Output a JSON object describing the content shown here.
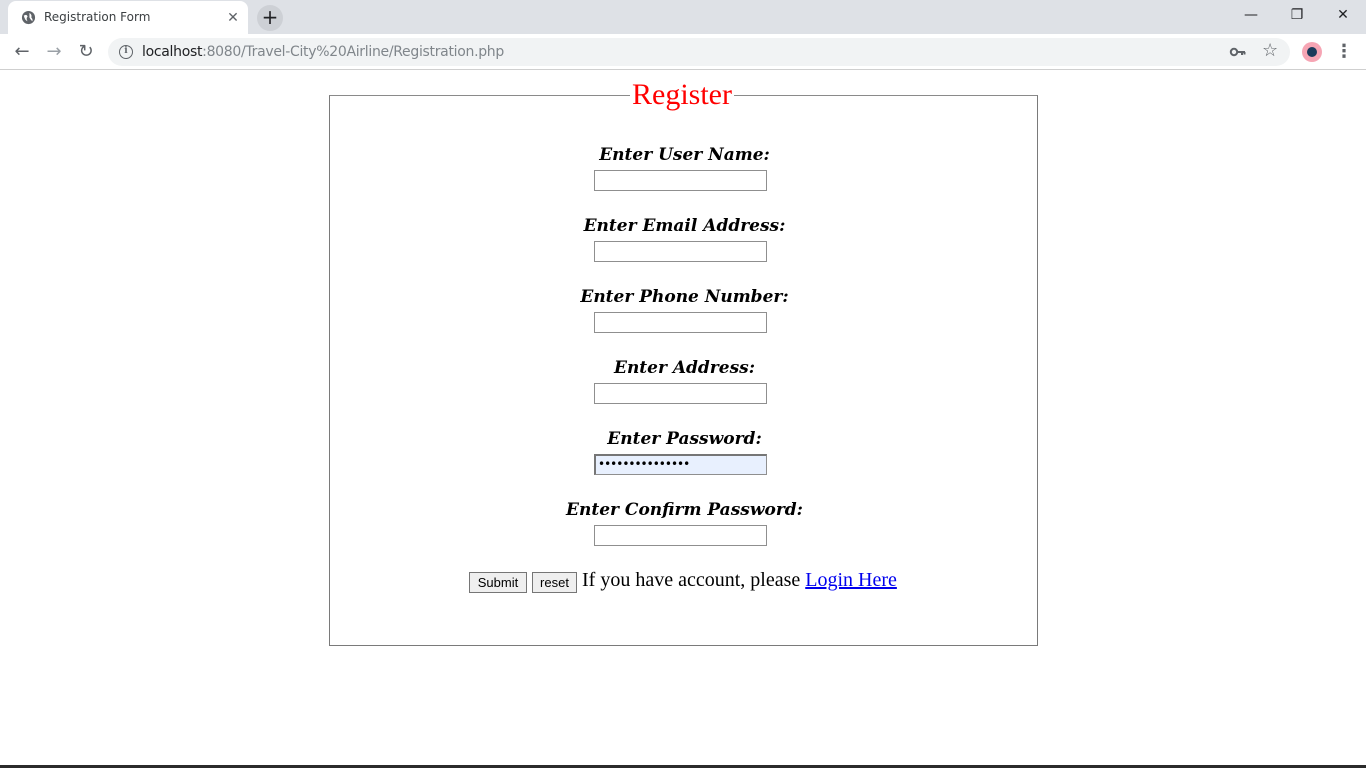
{
  "browser": {
    "tab_title": "Registration Form",
    "url_host": "localhost",
    "url_rest": ":8080/Travel-City%20Airline/Registration.php"
  },
  "form": {
    "legend": "Register",
    "fields": [
      {
        "label": "Enter User Name:",
        "value": ""
      },
      {
        "label": "Enter Email Address:",
        "value": ""
      },
      {
        "label": "Enter Phone Number:",
        "value": ""
      },
      {
        "label": "Enter Address:",
        "value": ""
      },
      {
        "label": "Enter Password:",
        "value": "•••••••••••••••"
      },
      {
        "label": "Enter Confirm Password:",
        "value": ""
      }
    ],
    "submit_label": "Submit",
    "reset_label": "reset",
    "prompt_text": "If you have account, please ",
    "login_link": "Login Here"
  }
}
